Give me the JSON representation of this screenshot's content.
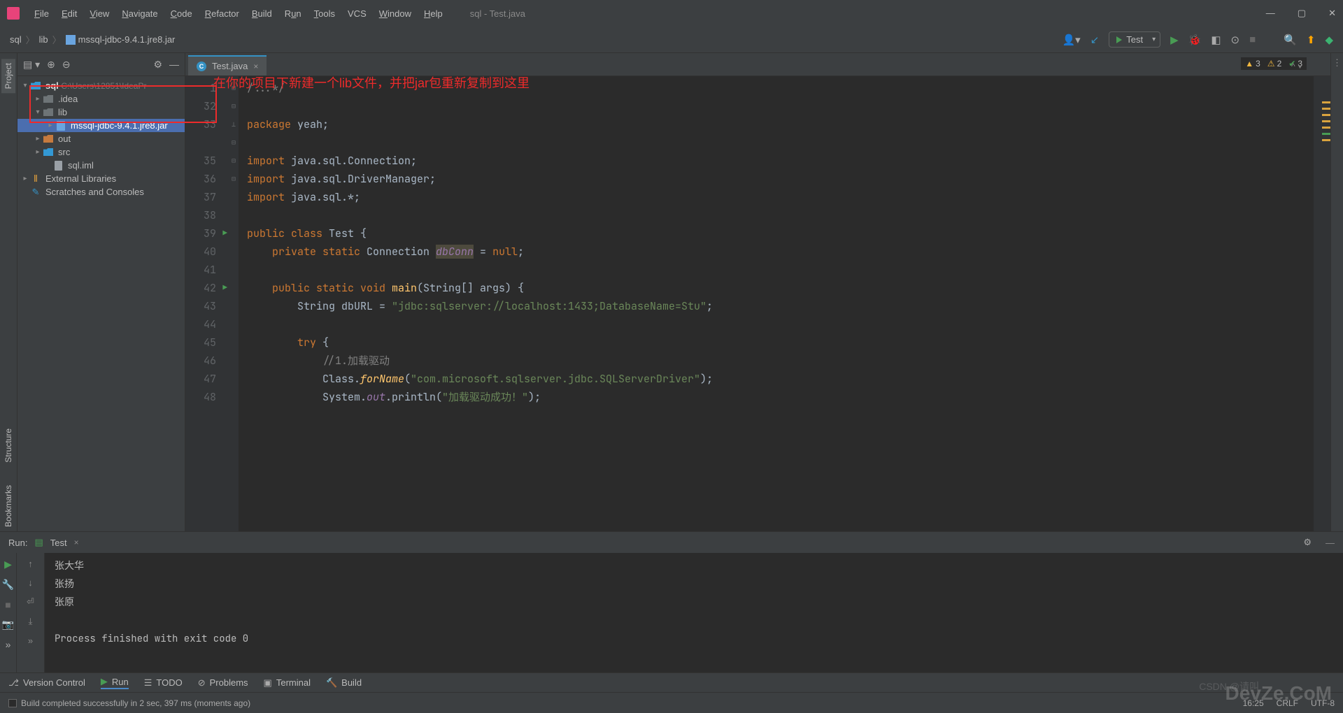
{
  "menu": {
    "file": "File",
    "edit": "Edit",
    "view": "View",
    "navigate": "Navigate",
    "code": "Code",
    "refactor": "Refactor",
    "build": "Build",
    "run": "Run",
    "tools": "Tools",
    "vcs": "VCS",
    "window": "Window",
    "help": "Help"
  },
  "window_title": "sql - Test.java",
  "breadcrumb": {
    "p1": "sql",
    "p2": "lib",
    "p3": "mssql-jdbc-9.4.1.jre8.jar"
  },
  "run_config": "Test",
  "sidebar_tabs": {
    "project": "Project",
    "structure": "Structure",
    "bookmarks": "Bookmarks"
  },
  "project_tree": {
    "root": "sql",
    "root_path": "C:\\Users\\12851\\IdeaPr",
    "idea": ".idea",
    "lib": "lib",
    "jar": "mssql-jdbc-9.4.1.jre8.jar",
    "out": "out",
    "src": "src",
    "iml": "sql.iml",
    "ext": "External Libraries",
    "scratch": "Scratches and Consoles"
  },
  "tab": {
    "name": "Test.java"
  },
  "annotation_text": "在你的项目下新建一个lib文件，并把jar包重新复制到这里",
  "inspections": {
    "warn1": "3",
    "warn2": "2",
    "ok": "3"
  },
  "code": {
    "l1": "/...*/",
    "l33": {
      "kw": "package",
      "id": " yeah;"
    },
    "l35": {
      "kw": "import",
      "id": " java.sql.Connection;"
    },
    "l36": {
      "kw": "import",
      "id": " java.sql.DriverManager;"
    },
    "l37": {
      "kw": "import",
      "id": " java.sql.*;"
    },
    "l39": {
      "a": "public class ",
      "b": "Test ",
      "c": "{"
    },
    "l40": {
      "a": "    private static ",
      "b": "Connection ",
      "c": "dbConn",
      "d": " = ",
      "e": "null",
      "f": ";"
    },
    "l42": {
      "a": "    public static void ",
      "b": "main",
      "c": "(String[] args) {"
    },
    "l43": {
      "a": "        String dbURL = ",
      "b": "\"jdbc:sqlserver://localhost:1433;DatabaseName=Stu\"",
      "c": ";"
    },
    "l45": {
      "a": "        try ",
      "b": "{"
    },
    "l46": {
      "a": "            ",
      "b": "//1.加载驱动"
    },
    "l47": {
      "a": "            Class.",
      "b": "forName",
      "c": "(",
      "d": "\"com.microsoft.sqlserver.jdbc.SQLServerDriver\"",
      "e": ");"
    },
    "l48": {
      "a": "            System.",
      "b": "out",
      "c": ".println(",
      "d": "\"加载驱动成功！\"",
      "e": ");"
    }
  },
  "line_nums": [
    "1",
    "32",
    "33",
    "",
    "35",
    "36",
    "37",
    "38",
    "39",
    "40",
    "41",
    "42",
    "43",
    "44",
    "45",
    "46",
    "47",
    "48"
  ],
  "run_panel": {
    "label": "Run:",
    "config": "Test",
    "out1": "张大华",
    "out2": "张扬",
    "out3": "张原",
    "exit": "Process finished with exit code 0"
  },
  "bottom_tabs": {
    "vc": "Version Control",
    "run": "Run",
    "todo": "TODO",
    "problems": "Problems",
    "terminal": "Terminal",
    "build": "Build"
  },
  "status": {
    "msg": "Build completed successfully in 2 sec, 397 ms (moments ago)",
    "pos": "16:25",
    "sep": "CRLF",
    "enc": "UTF-8"
  },
  "watermark": "DevZe.CoM",
  "csdn": "CSDN @请叫"
}
